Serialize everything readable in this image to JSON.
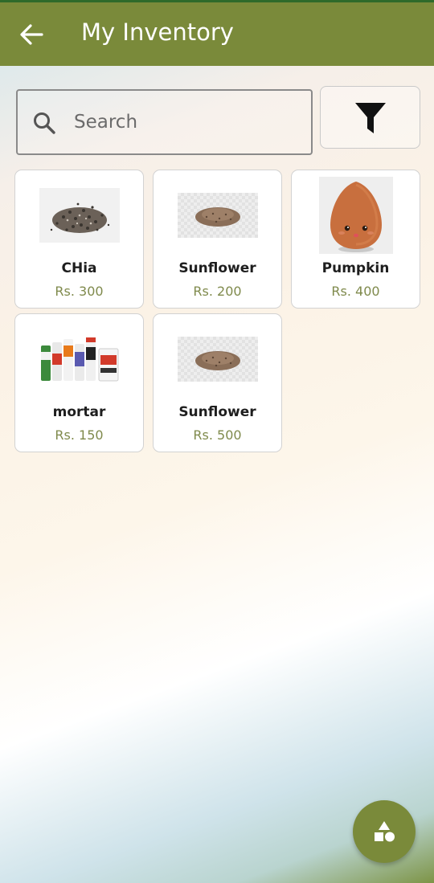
{
  "header": {
    "title": "My Inventory",
    "back_icon": "arrow-left-icon",
    "background_color": "#7a8a3a"
  },
  "search": {
    "placeholder": "Search",
    "value": "",
    "icon": "search-icon"
  },
  "filter": {
    "icon": "filter-funnel-icon"
  },
  "products": [
    {
      "name": "CHia",
      "price": "Rs. 300",
      "image": "chia-seeds-image"
    },
    {
      "name": "Sunflower",
      "price": "Rs. 200",
      "image": "seed-pile-image"
    },
    {
      "name": "Pumpkin",
      "price": "Rs. 400",
      "image": "almond-character-image"
    },
    {
      "name": "mortar",
      "price": "Rs. 150",
      "image": "product-bottles-image"
    },
    {
      "name": "Sunflower",
      "price": "Rs. 500",
      "image": "seed-pile-image"
    }
  ],
  "fab": {
    "icon": "shapes-icon"
  },
  "colors": {
    "accent": "#7a8a3a",
    "price_text": "#7f8a4c"
  }
}
